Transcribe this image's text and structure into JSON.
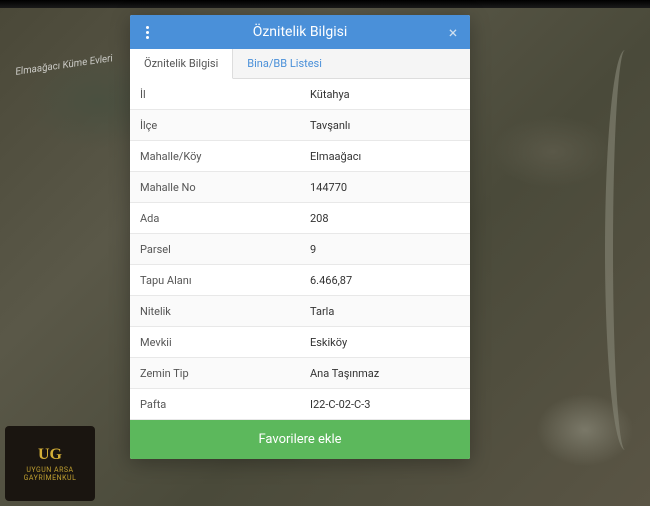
{
  "map": {
    "label": "Elmaağacı Küme Evleri"
  },
  "logo": {
    "initials": "UG",
    "line1": "UYGUN ARSA",
    "line2": "GAYRİMENKUL"
  },
  "dialog": {
    "title": "Öznitelik Bilgisi",
    "tabs": [
      {
        "label": "Öznitelik Bilgisi",
        "active": true
      },
      {
        "label": "Bina/BB Listesi",
        "active": false
      }
    ],
    "rows": [
      {
        "label": "İl",
        "value": "Kütahya"
      },
      {
        "label": "İlçe",
        "value": "Tavşanlı"
      },
      {
        "label": "Mahalle/Köy",
        "value": "Elmaağacı"
      },
      {
        "label": "Mahalle No",
        "value": "144770"
      },
      {
        "label": "Ada",
        "value": "208"
      },
      {
        "label": "Parsel",
        "value": "9"
      },
      {
        "label": "Tapu Alanı",
        "value": "6.466,87"
      },
      {
        "label": "Nitelik",
        "value": "Tarla"
      },
      {
        "label": "Mevkii",
        "value": "Eskiköy"
      },
      {
        "label": "Zemin Tip",
        "value": "Ana Taşınmaz"
      },
      {
        "label": "Pafta",
        "value": "I22-C-02-C-3"
      }
    ],
    "favorite_label": "Favorilere ekle"
  }
}
